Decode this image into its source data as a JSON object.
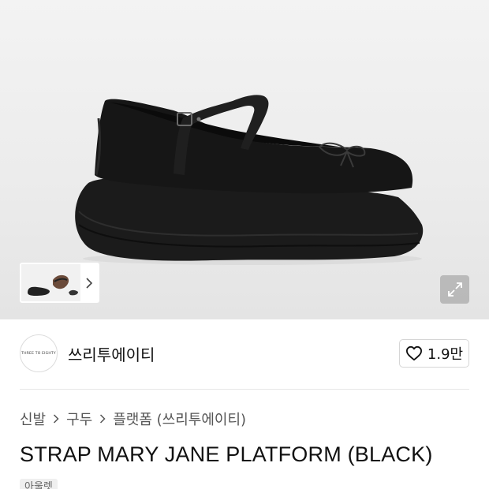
{
  "product_image": {
    "shoe_label": "THREE TO EIGHTY"
  },
  "thumbnails": {
    "count": 2
  },
  "brand": {
    "logo_text": "THREE TO EIGHTY",
    "name": "쓰리투에이티"
  },
  "like": {
    "count": "1.9만",
    "icon": "heart-icon"
  },
  "breadcrumb": [
    {
      "label": "신발"
    },
    {
      "label": "구두"
    },
    {
      "label": "플랫폼 (쓰리투에이티)"
    }
  ],
  "product": {
    "title": "STRAP MARY JANE PLATFORM (BLACK)",
    "tag": "아울렛"
  },
  "colors": {
    "hero_bg": "#ececec",
    "shoe": "#1a1a1a"
  }
}
